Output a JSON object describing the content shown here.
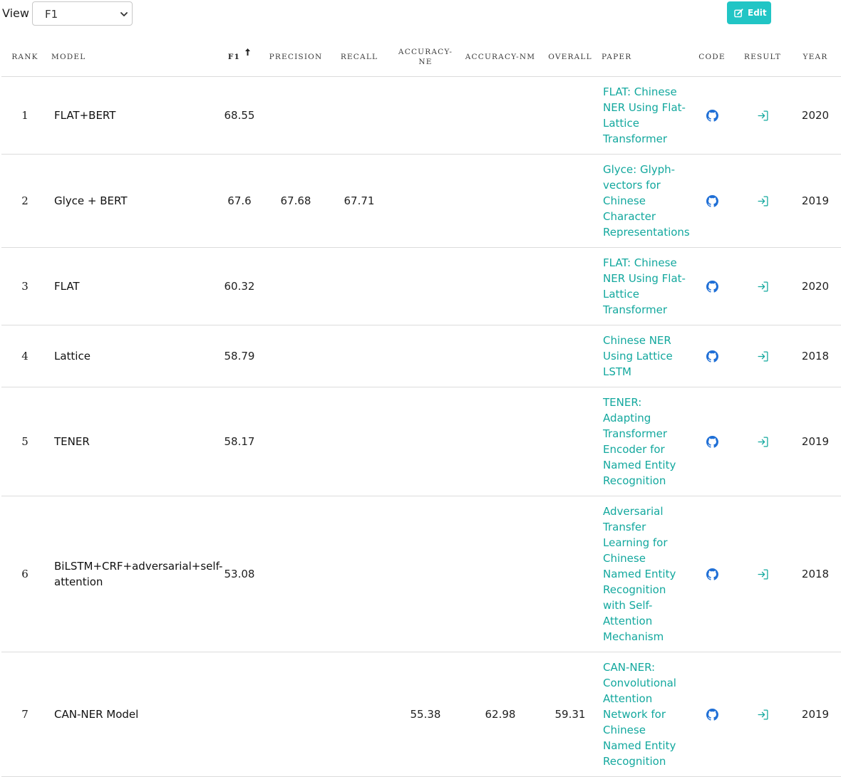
{
  "view": {
    "label": "View",
    "selected": "F1"
  },
  "edit_button": {
    "label": "Edit"
  },
  "columns": {
    "rank": "RANK",
    "model": "MODEL",
    "f1": "F1",
    "precision": "PRECISION",
    "recall": "RECALL",
    "accuracy_ne": "ACCURACY-NE",
    "accuracy_nm": "ACCURACY-NM",
    "overall": "OVERALL",
    "paper": "PAPER",
    "code": "CODE",
    "result": "RESULT",
    "year": "YEAR"
  },
  "colors": {
    "accent": "#21c5c5",
    "paper_link": "#13a89e",
    "code_icon": "#1f6fd6",
    "result_icon": "#13a89e"
  },
  "icons": {
    "view_select": "chevron-down-icon",
    "edit": "edit-icon",
    "sort": "sort-up-arrow-icon",
    "code": "github-icon",
    "result": "sign-in-icon"
  },
  "rows": [
    {
      "rank": "1",
      "model": "FLAT+BERT",
      "f1": "68.55",
      "precision": "",
      "recall": "",
      "accuracy_ne": "",
      "accuracy_nm": "",
      "overall": "",
      "paper": "FLAT: Chinese NER Using Flat-Lattice Transformer",
      "year": "2020"
    },
    {
      "rank": "2",
      "model": "Glyce + BERT",
      "f1": "67.6",
      "precision": "67.68",
      "recall": "67.71",
      "accuracy_ne": "",
      "accuracy_nm": "",
      "overall": "",
      "paper": "Glyce: Glyph-vectors for Chinese Character Representations",
      "year": "2019"
    },
    {
      "rank": "3",
      "model": "FLAT",
      "f1": "60.32",
      "precision": "",
      "recall": "",
      "accuracy_ne": "",
      "accuracy_nm": "",
      "overall": "",
      "paper": "FLAT: Chinese NER Using Flat-Lattice Transformer",
      "year": "2020"
    },
    {
      "rank": "4",
      "model": "Lattice",
      "f1": "58.79",
      "precision": "",
      "recall": "",
      "accuracy_ne": "",
      "accuracy_nm": "",
      "overall": "",
      "paper": "Chinese NER Using Lattice LSTM",
      "year": "2018"
    },
    {
      "rank": "5",
      "model": "TENER",
      "f1": "58.17",
      "precision": "",
      "recall": "",
      "accuracy_ne": "",
      "accuracy_nm": "",
      "overall": "",
      "paper": "TENER: Adapting Transformer Encoder for Named Entity Recognition",
      "year": "2019"
    },
    {
      "rank": "6",
      "model": "BiLSTM+CRF+adversarial+self-attention",
      "f1": "53.08",
      "precision": "",
      "recall": "",
      "accuracy_ne": "",
      "accuracy_nm": "",
      "overall": "",
      "paper": "Adversarial Transfer Learning for Chinese Named Entity Recognition with Self-Attention Mechanism",
      "year": "2018"
    },
    {
      "rank": "7",
      "model": "CAN-NER Model",
      "f1": "",
      "precision": "",
      "recall": "",
      "accuracy_ne": "55.38",
      "accuracy_nm": "62.98",
      "overall": "59.31",
      "paper": "CAN-NER: Convolutional Attention Network for Chinese Named Entity Recognition",
      "year": "2019"
    }
  ]
}
